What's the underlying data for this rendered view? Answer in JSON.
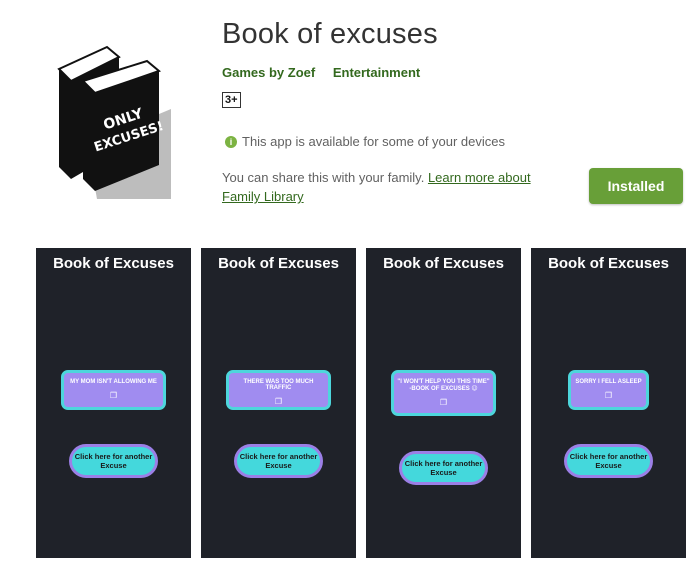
{
  "app": {
    "title": "Book of excuses",
    "developer": "Games by Zoef",
    "category": "Entertainment",
    "rating_badge": "3+",
    "icon_text": "ONLY EXCUSES!",
    "availability": "This app is available for some of your devices",
    "share_text": "You can share this with your family.",
    "share_link": "Learn more about Family Library",
    "install_label": "Installed"
  },
  "screenshots": [
    {
      "title": "Book of Excuses",
      "excuse": "MY MOM ISN'T ALLOWING ME",
      "button": "Click here for another Excuse"
    },
    {
      "title": "Book of Excuses",
      "excuse": "THERE WAS TOO MUCH TRAFFIC",
      "button": "Click here for another Excuse"
    },
    {
      "title": "Book of Excuses",
      "excuse": "\"I WON'T HELP YOU THIS TIME\" -BOOK OF EXCUSES 😉",
      "button": "Click here for another Excuse"
    },
    {
      "title": "Book of Excuses",
      "excuse": "SORRY I FELL ASLEEP",
      "button": "Click here for another Excuse"
    }
  ],
  "colors": {
    "accent_green": "#689f38",
    "link_green": "#33691e",
    "shot_bg": "#1f2229",
    "card_purple": "#a08cf0",
    "card_border": "#4dd6dc",
    "cta_cyan": "#44d8dc"
  }
}
